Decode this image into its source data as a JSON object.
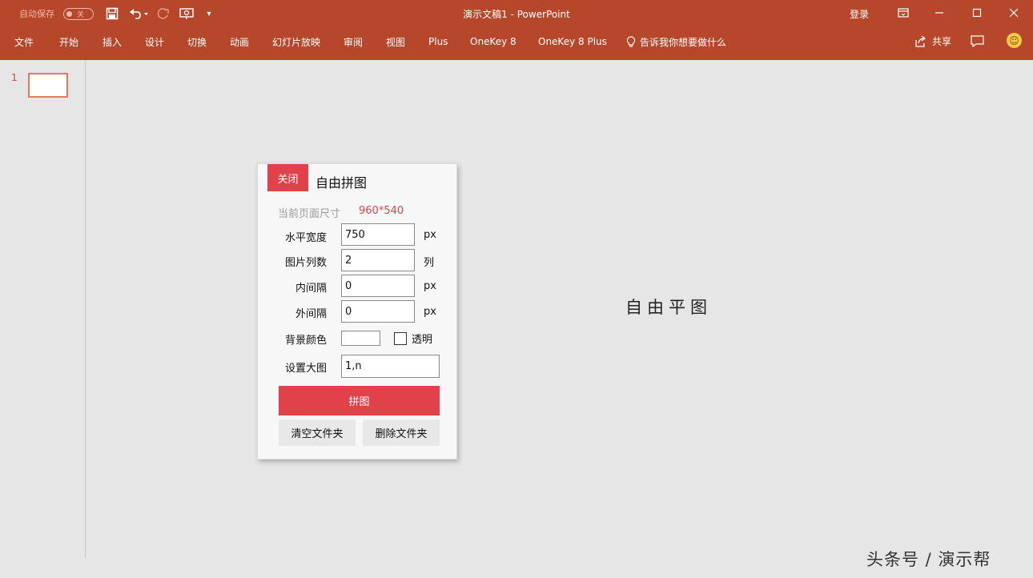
{
  "titlebar": {
    "autosave_label": "自动保存",
    "autosave_toggle": "关",
    "doc_title": "演示文稿1  -  PowerPoint",
    "login": "登录",
    "icons": [
      "save-icon",
      "undo-icon",
      "redo-icon",
      "present-icon",
      "customize-qat-icon",
      "ribbon-display-icon",
      "minimize-icon",
      "maximize-icon",
      "close-icon"
    ]
  },
  "ribbon": {
    "tabs": [
      "文件",
      "开始",
      "插入",
      "设计",
      "切换",
      "动画",
      "幻灯片放映",
      "审阅",
      "视图",
      "Plus",
      "OneKey 8",
      "OneKey 8 Plus"
    ],
    "tell_me": "告诉我你想要做什么",
    "share": "共享"
  },
  "thumbnails": {
    "slide_number": "1"
  },
  "slide": {
    "placeholder_text": "自由平图"
  },
  "dialog": {
    "close": "关闭",
    "title": "自由拼图",
    "page_size_label": "当前页面尺寸",
    "page_size_value": "960*540",
    "fields": [
      {
        "label": "水平宽度",
        "value": "750",
        "unit": "px"
      },
      {
        "label": "图片列数",
        "value": "2",
        "unit": "列"
      },
      {
        "label": "内间隔",
        "value": "0",
        "unit": "px"
      },
      {
        "label": "外间隔",
        "value": "0",
        "unit": "px"
      }
    ],
    "bg_color_label": "背景颜色",
    "bg_color": "#ffffff",
    "transparent_label": "透明",
    "big_image_label": "设置大图",
    "big_image_value": "1,n",
    "primary_button": "拼图",
    "clear_folder": "清空文件夹",
    "delete_folder": "删除文件夹",
    "accent_color": "#e0414a"
  },
  "watermark": "头条号 / 演示帮"
}
